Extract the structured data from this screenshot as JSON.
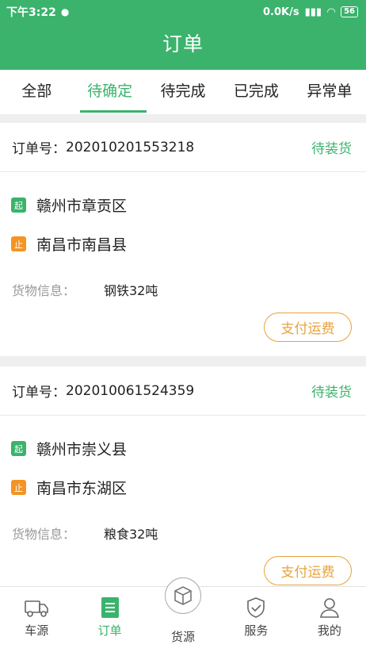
{
  "status_bar": {
    "time": "下午3:22",
    "speed": "0.0K/s",
    "battery": "56"
  },
  "header": {
    "title": "订单"
  },
  "tabs": [
    {
      "label": "全部"
    },
    {
      "label": "待确定"
    },
    {
      "label": "待完成"
    },
    {
      "label": "已完成"
    },
    {
      "label": "异常单"
    }
  ],
  "orders": [
    {
      "order_label": "订单号：",
      "order_no": "202010201553218",
      "status": "待装货",
      "start_tag": "起",
      "from": "赣州市章贡区",
      "end_tag": "止",
      "to": "南昌市南昌县",
      "cargo_label": "货物信息：",
      "cargo": "钢铁32吨",
      "pay_button": "支付运费"
    },
    {
      "order_label": "订单号：",
      "order_no": "202010061524359",
      "status": "待装货",
      "start_tag": "起",
      "from": "赣州市崇义县",
      "end_tag": "止",
      "to": "南昌市东湖区",
      "cargo_label": "货物信息：",
      "cargo": "粮食32吨",
      "pay_button": "支付运费"
    }
  ],
  "bottom_nav": [
    {
      "label": "车源",
      "icon": "truck-icon"
    },
    {
      "label": "订单",
      "icon": "order-icon"
    },
    {
      "label": "货源",
      "icon": "cargo-box-icon"
    },
    {
      "label": "服务",
      "icon": "shield-icon"
    },
    {
      "label": "我的",
      "icon": "user-icon"
    }
  ],
  "colors": {
    "primary": "#3bb36d",
    "accent": "#f39423",
    "button": "#e8a33c"
  }
}
